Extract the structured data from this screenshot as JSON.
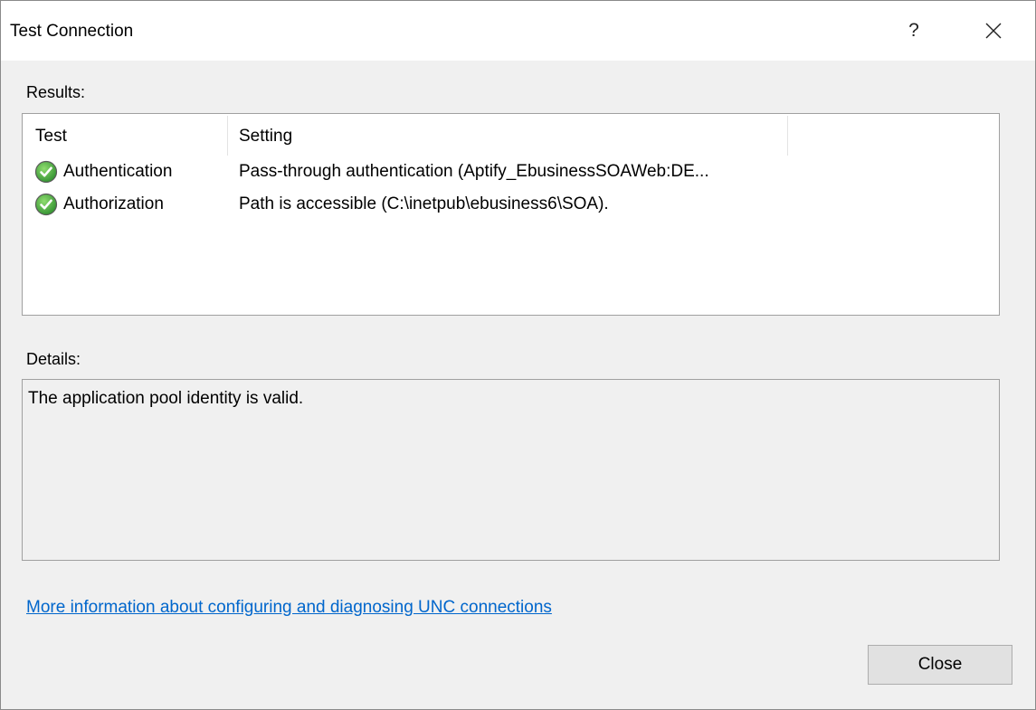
{
  "window": {
    "title": "Test Connection",
    "help_label": "?"
  },
  "results": {
    "label": "Results:",
    "columns": [
      "Test",
      "Setting"
    ],
    "rows": [
      {
        "test": "Authentication",
        "setting": "Pass-through authentication (Aptify_EbusinessSOAWeb:DE...",
        "status_icon": "check-circle-icon"
      },
      {
        "test": "Authorization",
        "setting": "Path is accessible (C:\\inetpub\\ebusiness6\\SOA).",
        "status_icon": "check-circle-icon"
      }
    ]
  },
  "details": {
    "label": "Details:",
    "text": "The application pool identity is valid."
  },
  "link": {
    "text": "More information about configuring and diagnosing UNC connections"
  },
  "buttons": {
    "close_label": "Close"
  },
  "colors": {
    "link": "#0066cc",
    "success_green": "#3aa63a",
    "window_bg": "#f0f0f0"
  }
}
